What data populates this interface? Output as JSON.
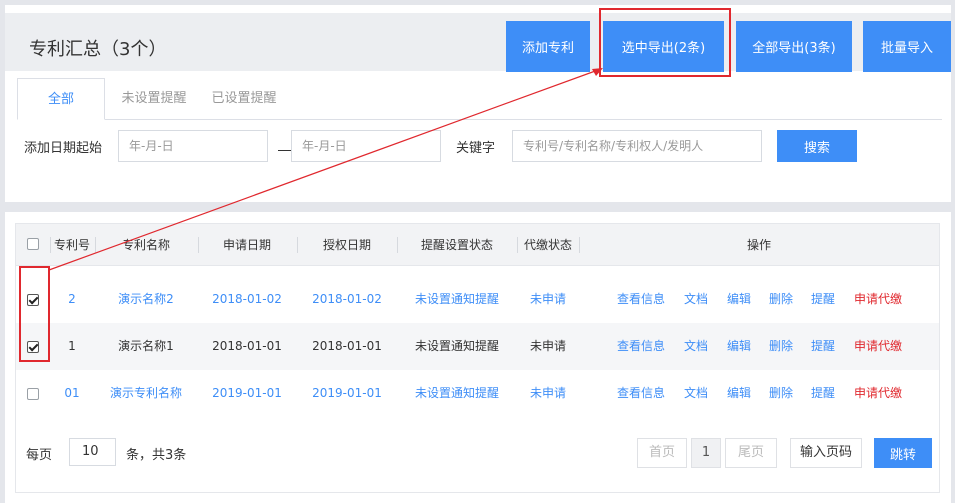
{
  "header": {
    "title": "专利汇总（3个）",
    "buttons": {
      "add": "添加专利",
      "export_selected": "选中导出(2条)",
      "export_all": "全部导出(3条)",
      "batch_import": "批量导入"
    }
  },
  "tabs": [
    {
      "label": "全部",
      "active": true
    },
    {
      "label": "未设置提醒",
      "active": false
    },
    {
      "label": "已设置提醒",
      "active": false
    }
  ],
  "filters": {
    "date_label": "添加日期起始",
    "date_start_placeholder": "年-月-日",
    "date_end_placeholder": "年-月-日",
    "keyword_label": "关键字",
    "keyword_placeholder": "专利号/专利名称/专利权人/发明人",
    "search_button": "搜索"
  },
  "table": {
    "columns": [
      "专利号",
      "专利名称",
      "申请日期",
      "授权日期",
      "提醒设置状态",
      "代缴状态",
      "操作"
    ],
    "rows": [
      {
        "checked": true,
        "number": "2",
        "name": "演示名称2",
        "apply_date": "2018-01-02",
        "grant_date": "2018-01-02",
        "remind_status": "未设置通知提醒",
        "pay_status": "未申请",
        "highlight": "blue"
      },
      {
        "checked": true,
        "number": "1",
        "name": "演示名称1",
        "apply_date": "2018-01-01",
        "grant_date": "2018-01-01",
        "remind_status": "未设置通知提醒",
        "pay_status": "未申请",
        "highlight": "dark"
      },
      {
        "checked": false,
        "number": "01",
        "name": "演示专利名称",
        "apply_date": "2019-01-01",
        "grant_date": "2019-01-01",
        "remind_status": "未设置通知提醒",
        "pay_status": "未申请",
        "highlight": "blue"
      }
    ],
    "actions": [
      "查看信息",
      "文档",
      "编辑",
      "删除",
      "提醒",
      "申请代缴"
    ]
  },
  "pager": {
    "per_page_label": "每页",
    "per_page_value": "10",
    "total_label": "条，共3条",
    "first": "首页",
    "current": "1",
    "last": "尾页",
    "goto_placeholder": "输入页码",
    "jump_button": "跳转"
  },
  "colors": {
    "accent": "#3e8ef7",
    "danger": "#e0282e"
  }
}
